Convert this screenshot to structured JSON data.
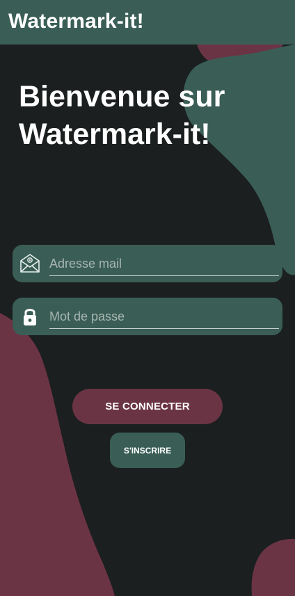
{
  "app_bar": {
    "title": "Watermark-it!"
  },
  "welcome": {
    "line1": "Bienvenue sur",
    "line2": "Watermark-it!"
  },
  "form": {
    "email": {
      "placeholder": "Adresse mail",
      "value": "",
      "icon": "envelope-icon"
    },
    "password": {
      "placeholder": "Mot de passe",
      "value": "",
      "icon": "lock-icon"
    }
  },
  "actions": {
    "login_label": "SE CONNECTER",
    "signup_label": "S'INSCRIRE"
  },
  "colors": {
    "background": "#1b1f1f",
    "green": "#3a5e55",
    "burgundy": "#6b3445",
    "text": "#ffffff"
  }
}
